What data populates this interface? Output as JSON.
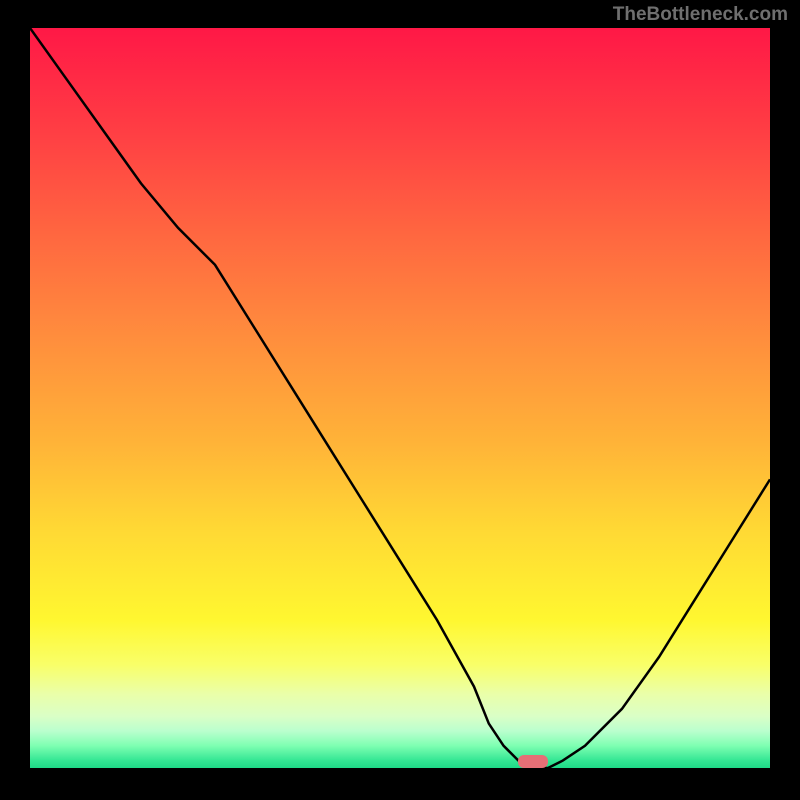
{
  "watermark": "TheBottleneck.com",
  "chart_data": {
    "type": "line",
    "title": "",
    "xlabel": "",
    "ylabel": "",
    "xlim": [
      0,
      100
    ],
    "ylim": [
      0,
      100
    ],
    "x": [
      0,
      5,
      10,
      15,
      20,
      25,
      30,
      35,
      40,
      45,
      50,
      55,
      60,
      62,
      64,
      66,
      68,
      70,
      72,
      75,
      80,
      85,
      90,
      95,
      100
    ],
    "y": [
      100,
      93,
      86,
      79,
      73,
      68,
      60,
      52,
      44,
      36,
      28,
      20,
      11,
      6,
      3,
      1,
      0,
      0,
      1,
      3,
      8,
      15,
      23,
      31,
      39
    ],
    "marker": {
      "x": 68,
      "y": 0
    },
    "gradient_colors": {
      "top": "#ff1846",
      "middle": "#ffd934",
      "bottom": "#1fd987"
    }
  }
}
